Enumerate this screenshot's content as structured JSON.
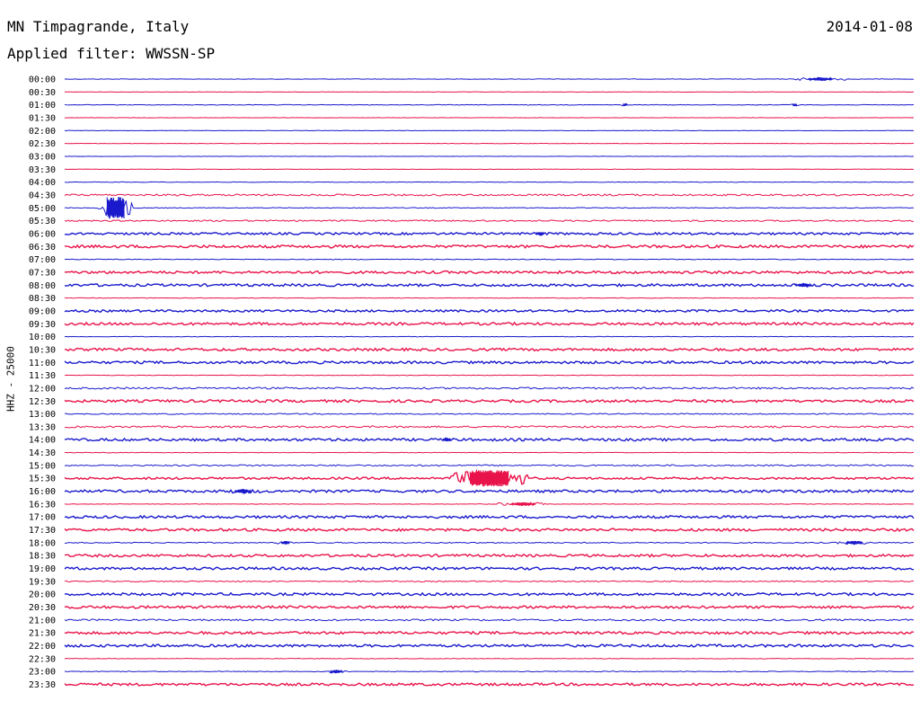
{
  "header": {
    "title": "MN Timpagrande, Italy",
    "date": "2014-01-08",
    "filter": "Applied filter: WWSSN-SP"
  },
  "axis": {
    "ylabel": "HHZ - 25000"
  },
  "colors": {
    "blue": "#1a1acc",
    "red": "#e8134a"
  },
  "chart_data": {
    "type": "line",
    "title": "MN Timpagrande, Italy",
    "ylabel": "HHZ - 25000",
    "time_labels": [
      "00:00",
      "00:30",
      "01:00",
      "01:30",
      "02:00",
      "02:30",
      "03:00",
      "03:30",
      "04:00",
      "04:30",
      "05:00",
      "05:30",
      "06:00",
      "06:30",
      "07:00",
      "07:30",
      "08:00",
      "08:30",
      "09:00",
      "09:30",
      "10:00",
      "10:30",
      "11:00",
      "11:30",
      "12:00",
      "12:30",
      "13:00",
      "13:30",
      "14:00",
      "14:30",
      "15:00",
      "15:30",
      "16:00",
      "16:30",
      "17:00",
      "17:30",
      "18:00",
      "18:30",
      "19:00",
      "19:30",
      "20:00",
      "20:30",
      "21:00",
      "21:30",
      "22:00",
      "22:30",
      "23:00",
      "23:30"
    ],
    "traces": [
      {
        "color": "blue",
        "noise": 0.3,
        "events": [
          {
            "t": 0.89,
            "amp": 2,
            "dur": 0.03
          }
        ]
      },
      {
        "color": "red",
        "noise": 0.2,
        "events": []
      },
      {
        "color": "blue",
        "noise": 0.3,
        "events": [
          {
            "t": 0.66,
            "amp": 1.5,
            "dur": 0.005
          },
          {
            "t": 0.86,
            "amp": 1.5,
            "dur": 0.005
          }
        ]
      },
      {
        "color": "red",
        "noise": 0.2,
        "events": []
      },
      {
        "color": "blue",
        "noise": 0.2,
        "events": []
      },
      {
        "color": "red",
        "noise": 0.2,
        "events": []
      },
      {
        "color": "blue",
        "noise": 0.2,
        "events": []
      },
      {
        "color": "red",
        "noise": 0.2,
        "events": []
      },
      {
        "color": "blue",
        "noise": 0.3,
        "events": []
      },
      {
        "color": "red",
        "noise": 1.0,
        "events": []
      },
      {
        "color": "blue",
        "noise": 0.4,
        "events": [
          {
            "t": 0.06,
            "amp": 12,
            "dur": 0.02
          }
        ]
      },
      {
        "color": "red",
        "noise": 0.8,
        "events": []
      },
      {
        "color": "blue",
        "noise": 1.2,
        "events": [
          {
            "t": 0.56,
            "amp": 2,
            "dur": 0.01
          }
        ]
      },
      {
        "color": "red",
        "noise": 1.5,
        "events": []
      },
      {
        "color": "blue",
        "noise": 0.4,
        "events": []
      },
      {
        "color": "red",
        "noise": 1.4,
        "events": []
      },
      {
        "color": "blue",
        "noise": 1.4,
        "events": [
          {
            "t": 0.87,
            "amp": 2,
            "dur": 0.02
          }
        ]
      },
      {
        "color": "red",
        "noise": 0.3,
        "events": []
      },
      {
        "color": "blue",
        "noise": 1.2,
        "events": []
      },
      {
        "color": "red",
        "noise": 1.4,
        "events": []
      },
      {
        "color": "blue",
        "noise": 0.3,
        "events": []
      },
      {
        "color": "red",
        "noise": 1.4,
        "events": []
      },
      {
        "color": "blue",
        "noise": 1.4,
        "events": []
      },
      {
        "color": "red",
        "noise": 0.3,
        "events": []
      },
      {
        "color": "blue",
        "noise": 1.0,
        "events": []
      },
      {
        "color": "red",
        "noise": 1.4,
        "events": []
      },
      {
        "color": "blue",
        "noise": 0.6,
        "events": []
      },
      {
        "color": "red",
        "noise": 1.0,
        "events": []
      },
      {
        "color": "blue",
        "noise": 1.4,
        "events": [
          {
            "t": 0.45,
            "amp": 2,
            "dur": 0.01
          }
        ]
      },
      {
        "color": "red",
        "noise": 0.3,
        "events": []
      },
      {
        "color": "blue",
        "noise": 0.8,
        "events": []
      },
      {
        "color": "red",
        "noise": 1.2,
        "events": [
          {
            "t": 0.5,
            "amp": 9,
            "dur": 0.045
          }
        ]
      },
      {
        "color": "blue",
        "noise": 1.4,
        "events": [
          {
            "t": 0.21,
            "amp": 2.5,
            "dur": 0.02
          }
        ]
      },
      {
        "color": "red",
        "noise": 0.3,
        "events": [
          {
            "t": 0.54,
            "amp": 2,
            "dur": 0.03
          }
        ]
      },
      {
        "color": "blue",
        "noise": 1.4,
        "events": []
      },
      {
        "color": "red",
        "noise": 1.4,
        "events": []
      },
      {
        "color": "blue",
        "noise": 0.6,
        "events": [
          {
            "t": 0.26,
            "amp": 2,
            "dur": 0.01
          },
          {
            "t": 0.93,
            "amp": 2,
            "dur": 0.02
          }
        ]
      },
      {
        "color": "red",
        "noise": 1.4,
        "events": []
      },
      {
        "color": "blue",
        "noise": 1.4,
        "events": []
      },
      {
        "color": "red",
        "noise": 0.6,
        "events": []
      },
      {
        "color": "blue",
        "noise": 1.4,
        "events": []
      },
      {
        "color": "red",
        "noise": 1.4,
        "events": []
      },
      {
        "color": "blue",
        "noise": 1.0,
        "events": []
      },
      {
        "color": "red",
        "noise": 1.4,
        "events": []
      },
      {
        "color": "blue",
        "noise": 1.4,
        "events": []
      },
      {
        "color": "red",
        "noise": 0.3,
        "events": []
      },
      {
        "color": "blue",
        "noise": 0.4,
        "events": [
          {
            "t": 0.32,
            "amp": 2,
            "dur": 0.015
          }
        ]
      },
      {
        "color": "red",
        "noise": 1.4,
        "events": []
      }
    ]
  }
}
